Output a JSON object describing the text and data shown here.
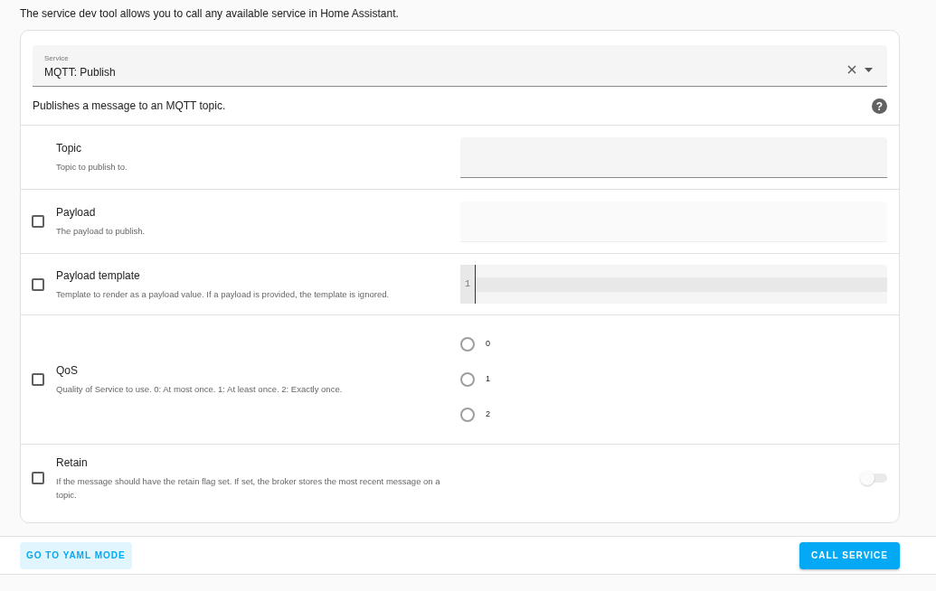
{
  "intro": "The service dev tool allows you to call any available service in Home Assistant.",
  "service": {
    "label": "Service",
    "value": "MQTT: Publish",
    "description": "Publishes a message to an MQTT topic.",
    "help_glyph": "?"
  },
  "fields": [
    {
      "kind": "text",
      "name": "Topic",
      "description": "Topic to publish to.",
      "disabled": false
    },
    {
      "kind": "text",
      "name": "Payload",
      "description": "The payload to publish.",
      "checked": false,
      "disabled": true
    },
    {
      "kind": "code",
      "name": "Payload template",
      "description": "Template to render as a payload value. If a payload is provided, the template is ignored.",
      "checked": false,
      "line_number": "1"
    },
    {
      "kind": "radio",
      "name": "QoS",
      "description": "Quality of Service to use. 0: At most once. 1: At least once. 2: Exactly once.",
      "checked": false,
      "options": [
        {
          "label": "0",
          "selected": false
        },
        {
          "label": "1",
          "selected": false
        },
        {
          "label": "2",
          "selected": false
        }
      ]
    },
    {
      "kind": "toggle",
      "name": "Retain",
      "description": "If the message should have the retain flag set. If set, the broker stores the most recent message on a topic.",
      "checked": false,
      "on": false,
      "disabled": true
    }
  ],
  "buttons": {
    "yaml": "GO TO YAML MODE",
    "call": "CALL SERVICE"
  }
}
